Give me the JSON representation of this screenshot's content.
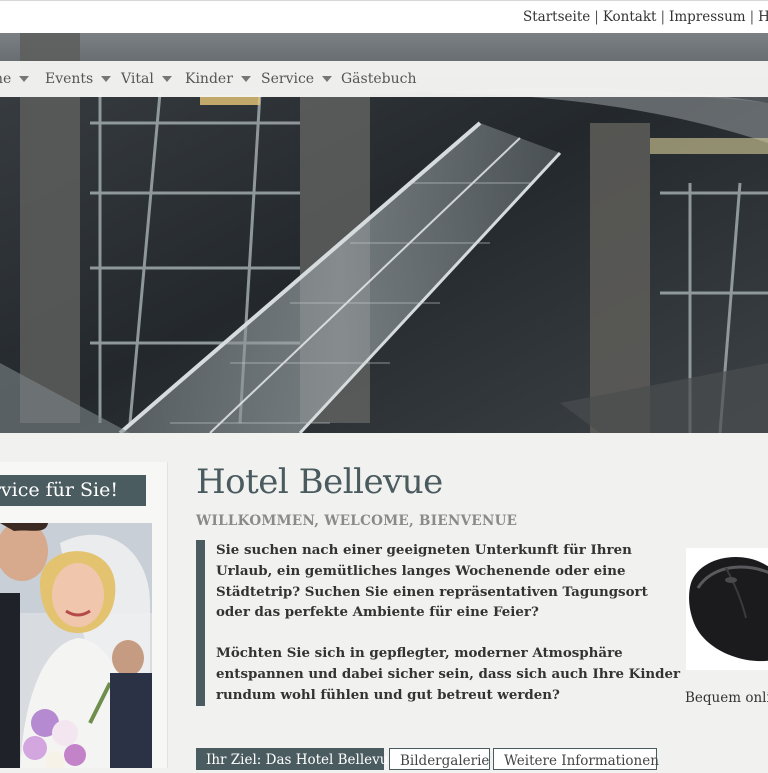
{
  "top_links": [
    "Startseite",
    "Kontakt",
    "Impressum",
    "Haftu"
  ],
  "top_separator": "|",
  "nav": {
    "items": [
      {
        "label": "ne",
        "has_dropdown": true
      },
      {
        "label": "Events",
        "has_dropdown": true
      },
      {
        "label": "Vital",
        "has_dropdown": true
      },
      {
        "label": "Kinder",
        "has_dropdown": true
      },
      {
        "label": "Service",
        "has_dropdown": true
      },
      {
        "label": "Gästebuch",
        "has_dropdown": false
      }
    ]
  },
  "sidebar": {
    "banner": "ervice für Sie!"
  },
  "main": {
    "title": "Hotel Bellevue",
    "subtitle": "WILLKOMMEN, WELCOME, BIENVENUE",
    "intro_1": "Sie suchen nach einer geeigneten Unterkunft für Ihren Urlaub, ein gemütliches langes Wochenende oder eine Städtetrip? Suchen Sie einen repräsentativen Tagungsort oder das perfekte Ambiente für eine Feier?",
    "intro_2": "Möchten Sie sich in gepflegter, moderner Atmosphäre entspannen und dabei sicher sein, dass sich auch Ihre Kinder rundum wohl fühlen und gut betreut werden?",
    "tabs": [
      {
        "label": "Ihr Ziel: Das Hotel Bellevue",
        "active": true
      },
      {
        "label": "Bildergalerie",
        "active": false
      },
      {
        "label": "Weitere Informationen",
        "active": false
      }
    ]
  },
  "ad": {
    "caption": "Bequem onlin"
  },
  "colors": {
    "accent": "#4b5c60",
    "page_background": "#f1f1ef"
  }
}
